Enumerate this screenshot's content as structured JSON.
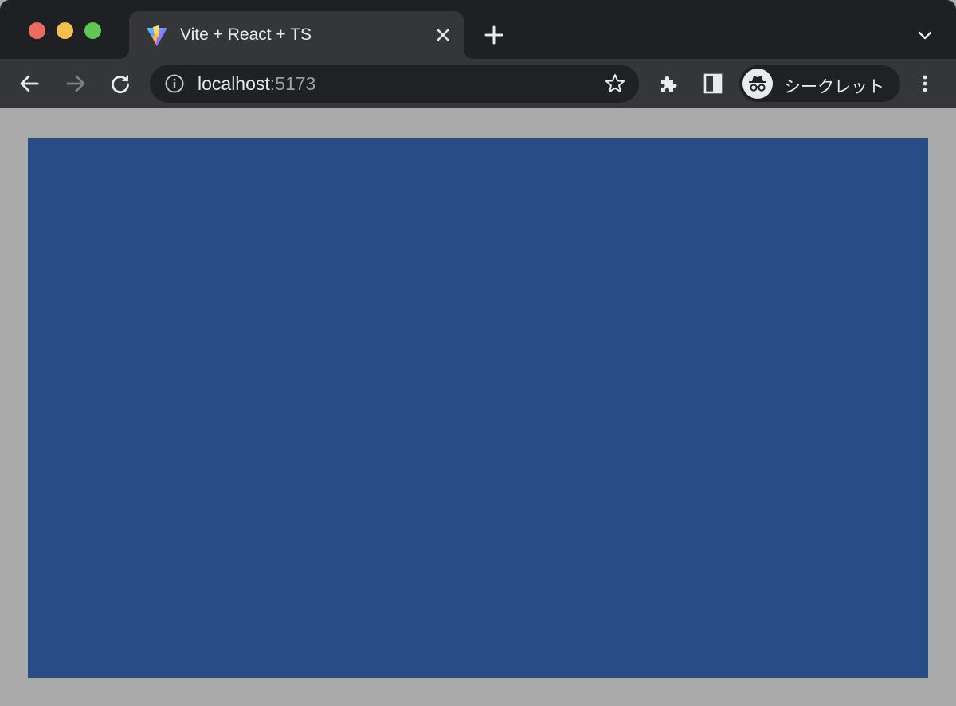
{
  "browser": {
    "tab": {
      "title": "Vite + React + TS",
      "favicon": "vite-logo-icon"
    },
    "omnibox": {
      "host": "localhost",
      "port": ":5173"
    },
    "profile": {
      "label": "シークレット",
      "icon": "incognito-icon"
    },
    "icons": {
      "back": "back-arrow-icon",
      "forward": "forward-arrow-icon",
      "reload": "reload-icon",
      "info": "info-icon",
      "star": "star-icon",
      "extensions": "puzzle-icon",
      "side_panel": "side-panel-icon",
      "menu": "kebab-menu-icon",
      "new_tab": "plus-icon",
      "tab_close": "close-icon",
      "tab_search": "chevron-down-icon"
    }
  },
  "page": {
    "canvas_color": "#284c85",
    "page_background": "#aaaaaa"
  }
}
